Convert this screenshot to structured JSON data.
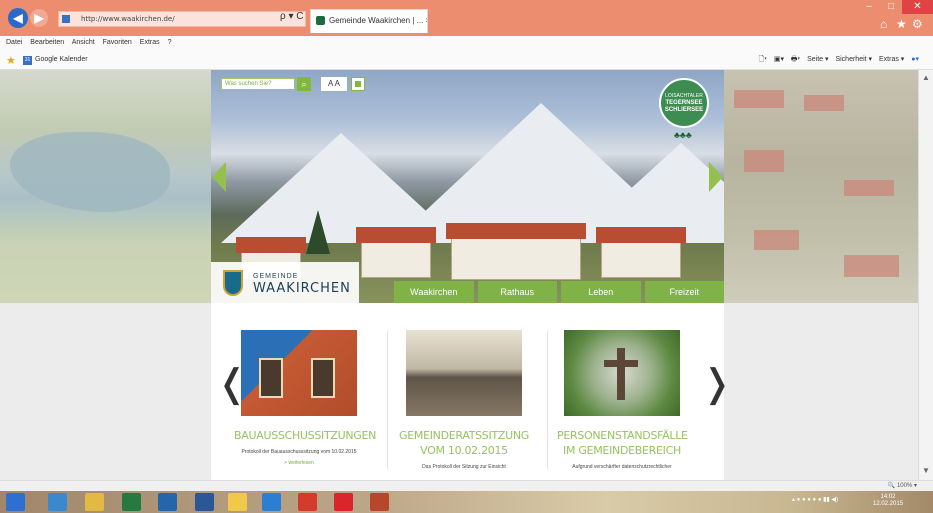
{
  "browser": {
    "address": "http://www.waakirchen.de/",
    "tab_title": "Gemeinde Waakirchen | ... ×",
    "addr_tools": "ρ ▾ C",
    "menu": [
      "Datei",
      "Bearbeiten",
      "Ansicht",
      "Favoriten",
      "Extras",
      "?"
    ],
    "favorites": [
      {
        "label": "Google Kalender"
      }
    ],
    "cmdbar": [
      "Seite ▾",
      "Sicherheit ▾",
      "Extras ▾"
    ],
    "zoom": "100%"
  },
  "site": {
    "search_placeholder": "Was suchen Sie?",
    "font_button": "A A",
    "badge_lines": [
      "LOISACHTALER",
      "TEGERNSEE",
      "SCHLIERSEE"
    ],
    "logo_small": "GEMEINDE",
    "logo_big": "WAAKIRCHEN",
    "nav": [
      "Waakirchen",
      "Rathaus",
      "Leben",
      "Freizeit"
    ],
    "cards": [
      {
        "title": "BAUAUSSCHUSSITZUNGEN",
        "text": "Protokoll der Bauausschusssitzung vom 10.02.2015",
        "more": "> weiterlesen"
      },
      {
        "title": "GEMEINDERATSSITZUNG VOM 10.02.2015",
        "text": "Das Protokoll der Sitzung zur Einsicht",
        "more": ""
      },
      {
        "title": "PERSONENSTANDSFÄLLE IM GEMEINDEBEREICH",
        "text": "Aufgrund verschärfter datenschutzrechtlicher",
        "more": ""
      }
    ]
  },
  "taskbar": {
    "clock_time": "14:02",
    "clock_date": "12.02.2015"
  },
  "colors": {
    "accent": "#7fb247",
    "titlebar": "#ec8d6f",
    "nav_green": "#82b83e"
  }
}
